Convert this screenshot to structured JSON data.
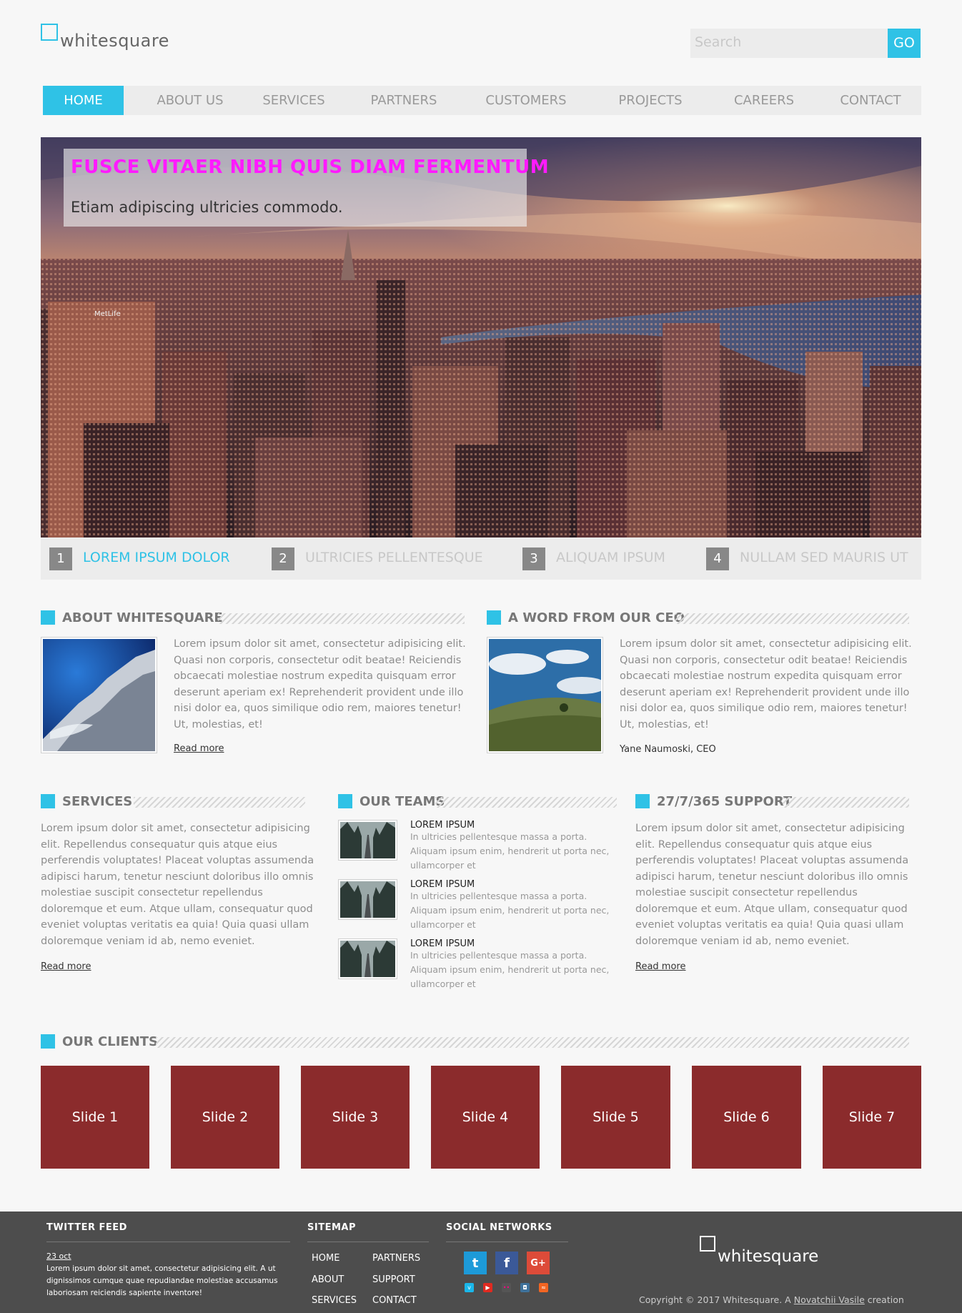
{
  "header": {
    "logo_text": "whitesquare",
    "search_placeholder": "Search",
    "go_label": "GO"
  },
  "nav": [
    "HOME",
    "ABOUT US",
    "SERVICES",
    "PARTNERS",
    "CUSTOMERS",
    "PROJECTS",
    "CAREERS",
    "CONTACT"
  ],
  "hero": {
    "title": "FUSCE VITAER NIBH QUIS DIAM FERMENTUM",
    "subtitle": "Etiam adipiscing ultricies commodo.",
    "billboard_text": "MetLife"
  },
  "slider_tabs": [
    {
      "num": "1",
      "label": "LOREM IPSUM DOLOR"
    },
    {
      "num": "2",
      "label": "ULTRICIES PELLENTESQUE"
    },
    {
      "num": "3",
      "label": "ALIQUAM IPSUM"
    },
    {
      "num": "4",
      "label": "NULLAM SED MAURIS UT"
    }
  ],
  "about": {
    "heading": "ABOUT WHITESQUARE",
    "text": "Lorem ipsum dolor sit amet, consectetur adipisicing elit. Quasi non corporis, consectetur odit beatae! Reiciendis obcaecati molestiae nostrum expedita quisquam error deserunt aperiam ex! Reprehenderit provident unde illo nisi dolor ea, quos similique odio rem, maiores tenetur! Ut, molestias, et!",
    "read_more": "Read more"
  },
  "ceo": {
    "heading": "A WORD FROM OUR CEO",
    "text": "Lorem ipsum dolor sit amet, consectetur adipisicing elit. Quasi non corporis, consectetur odit beatae! Reiciendis obcaecati molestiae nostrum expedita quisquam error deserunt aperiam ex! Reprehenderit provident unde illo nisi dolor ea, quos similique odio rem, maiores tenetur! Ut, molestias, et!",
    "signature": "Yane Naumoski, CEO"
  },
  "services": {
    "heading": "SERVICES",
    "text": "Lorem ipsum dolor sit amet, consectetur adipisicing elit. Repellendus consequatur quis atque eius perferendis voluptates! Placeat voluptas assumenda adipisci harum, tenetur nesciunt doloribus illo omnis molestiae suscipit consectetur repellendus doloremque et eum. Atque ullam, consequatur quod eveniet voluptas veritatis ea quia! Quia quasi ullam doloremque veniam id ab, nemo eveniet.",
    "read_more": "Read more"
  },
  "teams": {
    "heading": "OUR TEAMS",
    "items": [
      {
        "title": "LOREM IPSUM",
        "desc": "In ultricies pellentesque massa a porta. Aliquam ipsum enim, hendrerit ut porta nec, ullamcorper et"
      },
      {
        "title": "LOREM IPSUM",
        "desc": "In ultricies pellentesque massa a porta. Aliquam ipsum enim, hendrerit ut porta nec, ullamcorper et"
      },
      {
        "title": "LOREM IPSUM",
        "desc": "In ultricies pellentesque massa a porta. Aliquam ipsum enim, hendrerit ut porta nec, ullamcorper et"
      }
    ]
  },
  "support": {
    "heading": "27/7/365 SUPPORT",
    "text": "Lorem ipsum dolor sit amet, consectetur adipisicing elit. Repellendus consequatur quis atque eius perferendis voluptates! Placeat voluptas assumenda adipisci harum, tenetur nesciunt doloribus illo omnis molestiae suscipit consectetur repellendus doloremque et eum. Atque ullam, consequatur quod eveniet voluptas veritatis ea quia! Quia quasi ullam doloremque veniam id ab, nemo eveniet.",
    "read_more": "Read more"
  },
  "clients": {
    "heading": "OUR CLIENTS",
    "slides": [
      "Slide 1",
      "Slide 2",
      "Slide 3",
      "Slide 4",
      "Slide 5",
      "Slide 6",
      "Slide 7"
    ]
  },
  "footer": {
    "twitter_heading": "TWITTER FEED",
    "tweet_date": "23 oct",
    "tweet_text": "Lorem ipsum dolor sit amet, consectetur adipisicing elit. A ut dignissimos cumque quae repudiandae molestiae accusamus laboriosam reiciendis sapiente inventore!",
    "sitemap_heading": "SITEMAP",
    "sitemap_col1": [
      "HOME",
      "ABOUT",
      "SERVICES"
    ],
    "sitemap_col2": [
      "PARTNERS",
      "SUPPORT",
      "CONTACT"
    ],
    "social_heading": "SOCIAL NETWORKS",
    "social_big": [
      "t",
      "f",
      "G+"
    ],
    "social_small": [
      "v",
      "▶",
      "••",
      "◘",
      "≈"
    ],
    "logo_text": "whitesquare",
    "copyright_prefix": "Copyright © 2017 Whitesquare. A ",
    "copyright_author": "Novatchii Vasile",
    "copyright_suffix": " creation"
  },
  "colors": {
    "accent": "#2fc2e6",
    "hero_title": "#ff1aff",
    "slide_bg": "#8b2b2c",
    "footer_bg": "#4d4d4d"
  }
}
